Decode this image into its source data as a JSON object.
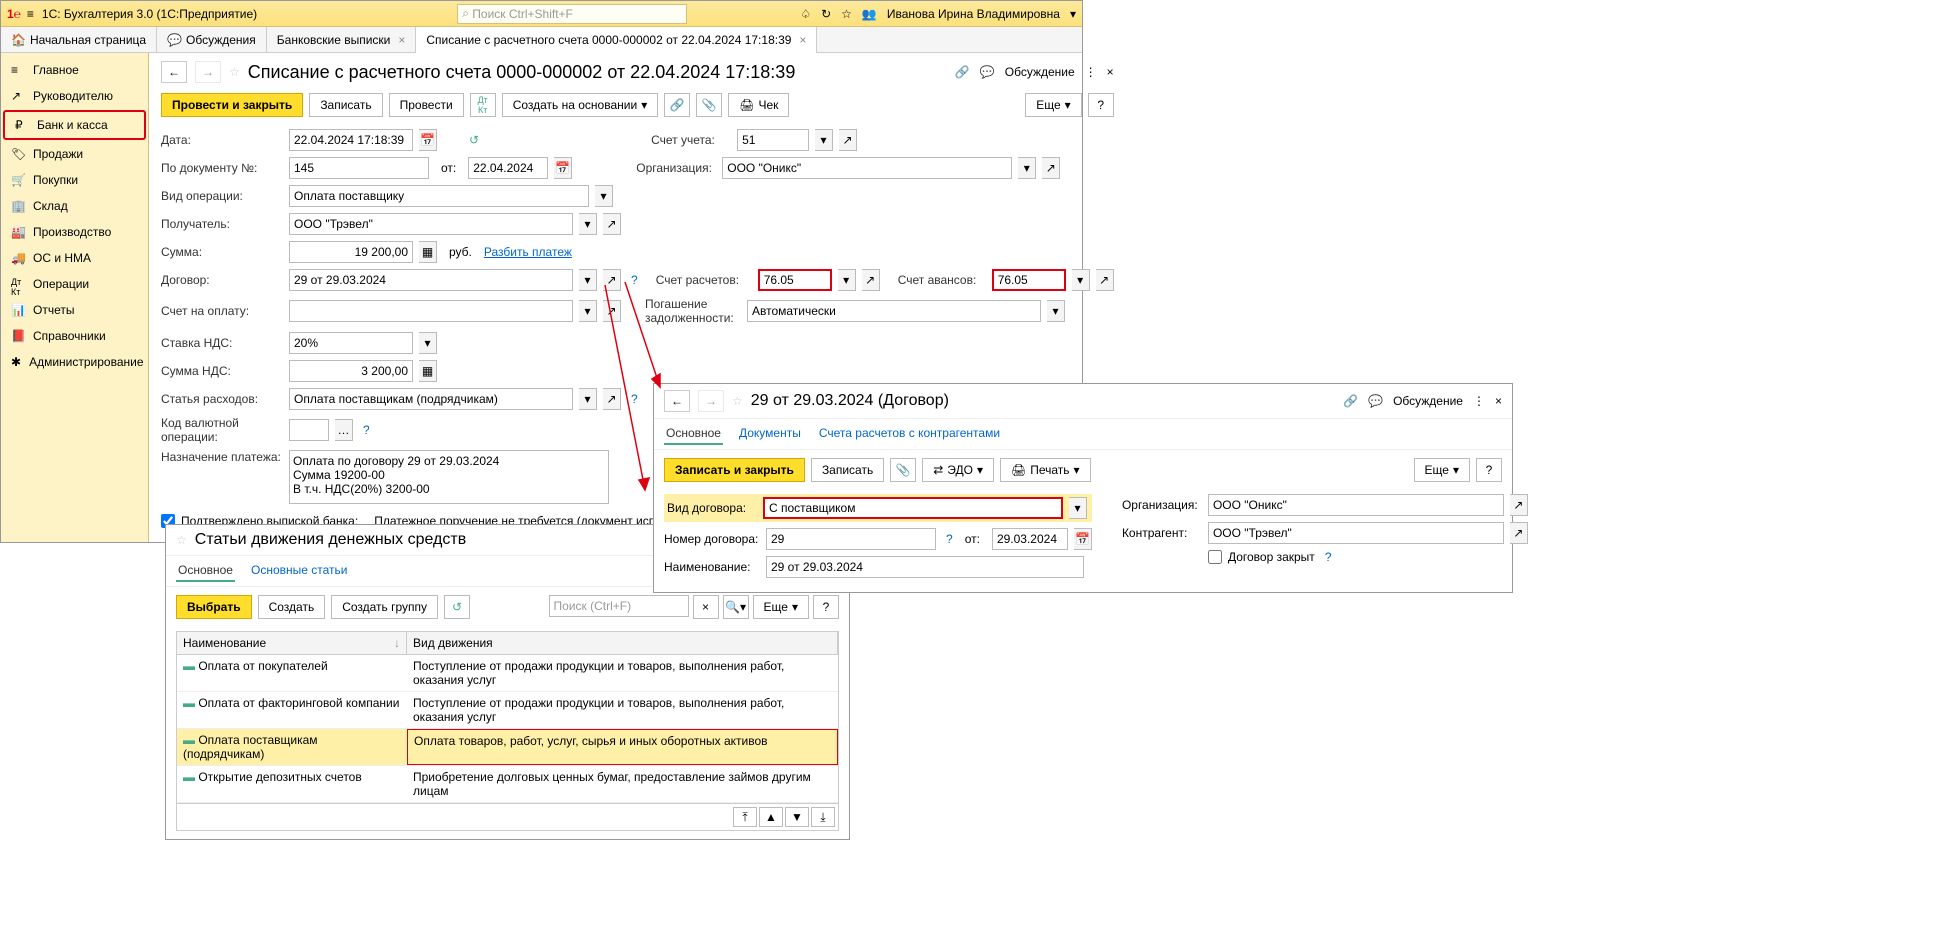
{
  "titlebar": {
    "app": "1С: Бухгалтерия 3.0  (1С:Предприятие)",
    "search_ph": "Поиск Ctrl+Shift+F",
    "user": "Иванова Ирина Владимировна"
  },
  "tabs": {
    "home": "Начальная страница",
    "t1": "Обсуждения",
    "t2": "Банковские выписки",
    "t3": "Списание с расчетного счета 0000-000002 от 22.04.2024 17:18:39"
  },
  "sidebar": {
    "main": "Главное",
    "ruk": "Руководителю",
    "bank": "Банк и касса",
    "prod": "Продажи",
    "pok": "Покупки",
    "sklad": "Склад",
    "proizv": "Производство",
    "os": "ОС и НМА",
    "oper": "Операции",
    "otch": "Отчеты",
    "sprav": "Справочники",
    "admin": "Администрирование"
  },
  "doc": {
    "title": "Списание с расчетного счета 0000-000002 от 22.04.2024 17:18:39",
    "btn_post_close": "Провести и закрыть",
    "btn_save": "Записать",
    "btn_post": "Провести",
    "btn_create": "Создать на основании",
    "btn_chek": "Чек",
    "btn_more": "Еще",
    "lbl_date": "Дата:",
    "date": "22.04.2024 17:18:39",
    "lbl_docnum": "По документу №:",
    "docnum": "145",
    "lbl_ot": "от:",
    "docdate": "22.04.2024",
    "lbl_acct": "Счет учета:",
    "acct": "51",
    "lbl_org": "Организация:",
    "org": "ООО \"Оникс\"",
    "lbl_oper": "Вид операции:",
    "oper": "Оплата поставщику",
    "lbl_recv": "Получатель:",
    "recv": "ООО \"Трэвел\"",
    "lbl_sum": "Сумма:",
    "sum": "19 200,00",
    "rub": "руб.",
    "split": "Разбить платеж",
    "lbl_dog": "Договор:",
    "dog": "29 от 29.03.2024",
    "lbl_schrasch": "Счет расчетов:",
    "schrasch": "76.05",
    "lbl_schav": "Счет авансов:",
    "schav": "76.05",
    "lbl_schopl": "Счет на оплату:",
    "lbl_pogash": "Погашение задолженности:",
    "pogash": "Автоматически",
    "lbl_nds": "Ставка НДС:",
    "nds": "20%",
    "lbl_sumnds": "Сумма НДС:",
    "sumnds": "3 200,00",
    "lbl_rasx": "Статья расходов:",
    "rasx": "Оплата поставщикам (подрядчикам)",
    "lbl_kod": "Код валютной операции:",
    "lbl_nazn": "Назначение платежа:",
    "nazn1": "Оплата по договору 29 от 29.03.2024",
    "nazn2": "Сумма 19200-00",
    "nazn3": "В т.ч. НДС(20%) 3200-00",
    "chk": "Подтверждено выпиской банка:",
    "note": "Платежное поручение не требуется (документ исполнен ба",
    "discuss": "Обсуждение"
  },
  "p2": {
    "title": "29 от 29.03.2024 (Договор)",
    "tab_main": "Основное",
    "tab_docs": "Документы",
    "tab_sch": "Счета расчетов с контрагентами",
    "btn_save_close": "Записать и закрыть",
    "btn_save": "Записать",
    "btn_edo": "ЭДО",
    "btn_print": "Печать",
    "btn_more": "Еще",
    "lbl_vid": "Вид договора:",
    "vid": "С поставщиком",
    "lbl_org": "Организация:",
    "org": "ООО \"Оникс\"",
    "lbl_num": "Номер договора:",
    "num": "29",
    "lbl_ot": "от:",
    "date": "29.03.2024",
    "lbl_kontr": "Контрагент:",
    "kontr": "ООО \"Трэвел\"",
    "lbl_naim": "Наименование:",
    "naim": "29 от 29.03.2024",
    "chk_closed": "Договор закрыт",
    "discuss": "Обсуждение"
  },
  "p3": {
    "title": "Статьи движения денежных средств",
    "tab_main": "Основное",
    "tab_osn": "Основные статьи",
    "btn_select": "Выбрать",
    "btn_create": "Создать",
    "btn_group": "Создать группу",
    "search_ph": "Поиск (Ctrl+F)",
    "btn_more": "Еще",
    "col1": "Наименование",
    "col2": "Вид движения",
    "r1n": "Оплата от покупателей",
    "r1v": "Поступление от продажи продукции и товаров, выполнения работ, оказания услуг",
    "r2n": "Оплата от факторинговой компании",
    "r2v": "Поступление от продажи продукции и товаров, выполнения работ, оказания услуг",
    "r3n": "Оплата поставщикам (подрядчикам)",
    "r3v": "Оплата товаров, работ, услуг, сырья и иных оборотных активов",
    "r4n": "Открытие депозитных счетов",
    "r4v": "Приобретение долговых ценных бумаг, предоставление займов другим лицам"
  }
}
